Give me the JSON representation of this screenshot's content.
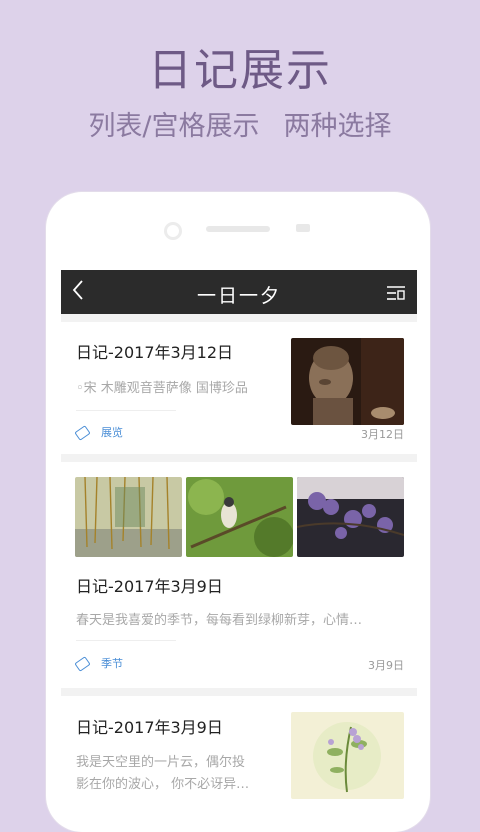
{
  "promo": {
    "headline": "日记展示",
    "sub_left": "列表/宫格展示",
    "sub_right": "两种选择"
  },
  "app": {
    "title": "一日一夕",
    "back_icon": "chevron-left-icon",
    "menu_icon": "menu-icon"
  },
  "entries": [
    {
      "title": "日记-2017年3月12日",
      "desc": "◦宋 木雕观音菩萨像 国博珍品",
      "tag": "展览",
      "date": "3月12日"
    },
    {
      "title": "日记-2017年3月9日",
      "desc": "春天是我喜爱的季节，每每看到绿柳新芽，心情…",
      "tag": "季节",
      "date": "3月9日"
    },
    {
      "title": "日记-2017年3月9日",
      "desc_line1": "我是天空里的一片云，偶尔投",
      "desc_line2": "影在你的波心， 你不必讶异…"
    }
  ],
  "colors": {
    "background": "#ddd2ea",
    "headline": "#6e5a86",
    "navbar": "#2b2b2b",
    "tag": "#4a8ed6"
  }
}
